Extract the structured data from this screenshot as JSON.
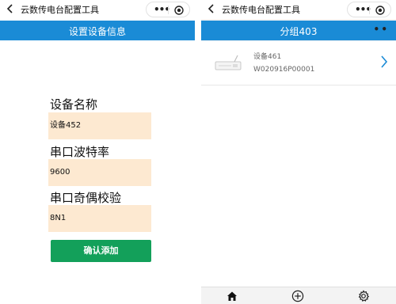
{
  "app": {
    "title": "云数传电台配置工具"
  },
  "left": {
    "header_title": "设置设备信息",
    "fields": [
      {
        "label": "设备名称",
        "value": "设备452"
      },
      {
        "label": "串口波特率",
        "value": "9600"
      },
      {
        "label": "串口奇偶校验",
        "value": "8N1"
      }
    ],
    "confirm_label": "确认添加"
  },
  "right": {
    "header_title": "分组403",
    "devices": [
      {
        "name": "设备461",
        "code": "W020916P00001"
      }
    ],
    "tabbar": {
      "items": [
        "home-icon",
        "add-circle-icon",
        "gear-icon"
      ]
    }
  },
  "colors": {
    "header_blue": "#1a8bd6",
    "input_bg": "#fde9d1",
    "confirm_green": "#13a05a"
  }
}
